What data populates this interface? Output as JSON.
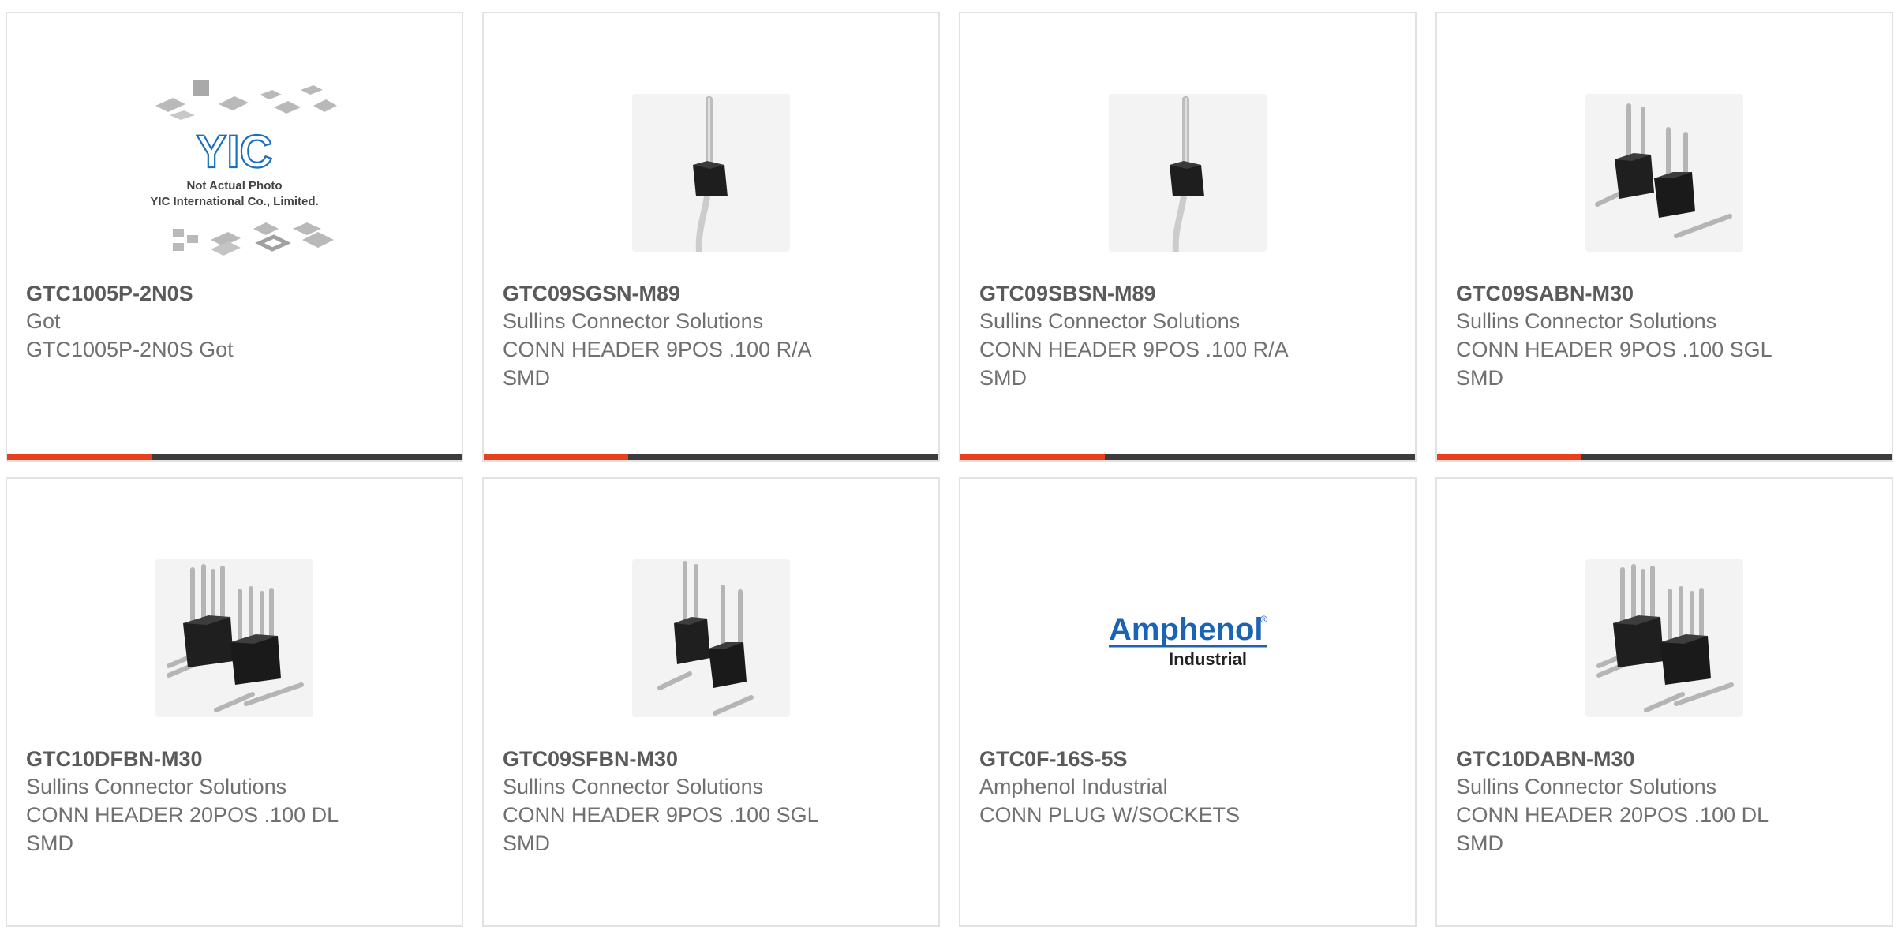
{
  "theme": {
    "accent": "#e8401c",
    "bar_dark": "#3c3c3c",
    "amphenol_blue": "#1b63b5",
    "yic_blue": "#1b6fbf"
  },
  "products": [
    {
      "part_number": "GTC1005P-2N0S",
      "manufacturer": "Got",
      "description": "GTC1005P-2N0S Got",
      "image": "yic-placeholder",
      "placeholder": {
        "logo": "YIC",
        "line1": "Not Actual Photo",
        "line2": "YIC International Co., Limited."
      }
    },
    {
      "part_number": "GTC09SGSN-M89",
      "manufacturer": "Sullins Connector Solutions",
      "description": "CONN HEADER 9POS .100 R/A SMD",
      "image": "single-pin-header-icon"
    },
    {
      "part_number": "GTC09SBSN-M89",
      "manufacturer": "Sullins Connector Solutions",
      "description": "CONN HEADER 9POS .100 R/A SMD",
      "image": "single-pin-header-icon"
    },
    {
      "part_number": "GTC09SABN-M30",
      "manufacturer": "Sullins Connector Solutions",
      "description": "CONN HEADER 9POS .100 SGL SMD",
      "image": "single-row-header-icon"
    },
    {
      "part_number": "GTC10DFBN-M30",
      "manufacturer": "Sullins Connector Solutions",
      "description": "CONN HEADER 20POS .100 DL SMD",
      "image": "dual-row-header-icon"
    },
    {
      "part_number": "GTC09SFBN-M30",
      "manufacturer": "Sullins Connector Solutions",
      "description": "CONN HEADER 9POS .100 SGL SMD",
      "image": "single-row-header-icon"
    },
    {
      "part_number": "GTC0F-16S-5S",
      "manufacturer": "Amphenol Industrial",
      "description": "CONN PLUG W/SOCKETS",
      "image": "amphenol-logo",
      "logo": {
        "name": "Amphenol",
        "registered": "®",
        "sub": "Industrial"
      }
    },
    {
      "part_number": "GTC10DABN-M30",
      "manufacturer": "Sullins Connector Solutions",
      "description": "CONN HEADER 20POS .100 DL SMD",
      "image": "dual-row-header-icon"
    }
  ]
}
